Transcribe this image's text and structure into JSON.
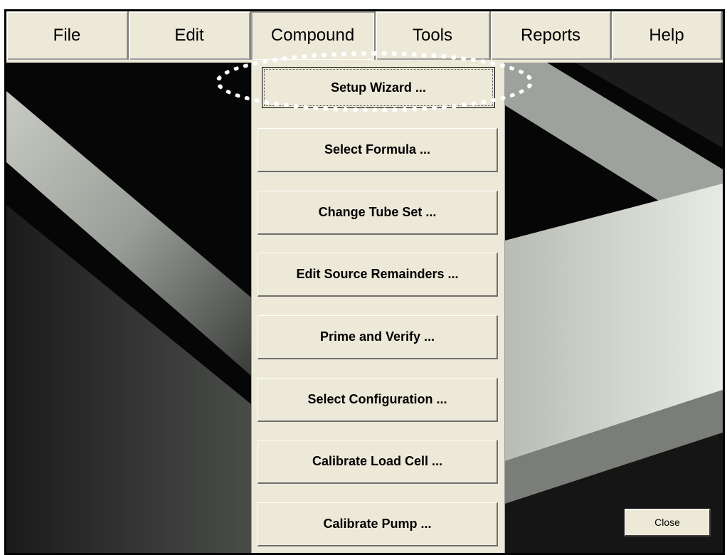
{
  "menubar": {
    "items": [
      {
        "label": "File"
      },
      {
        "label": "Edit"
      },
      {
        "label": "Compound"
      },
      {
        "label": "Tools"
      },
      {
        "label": "Reports"
      },
      {
        "label": "Help"
      }
    ]
  },
  "compound_menu": {
    "items": [
      {
        "label": "Setup Wizard ..."
      },
      {
        "label": "Select Formula ..."
      },
      {
        "label": "Change Tube Set ..."
      },
      {
        "label": "Edit Source Remainders ..."
      },
      {
        "label": "Prime and Verify ..."
      },
      {
        "label": "Select Configuration ..."
      },
      {
        "label": "Calibrate Load Cell ..."
      },
      {
        "label": "Calibrate Pump ..."
      }
    ]
  },
  "close_button": {
    "label": "Close"
  },
  "colors": {
    "window_bg": "#ece9d8",
    "highlight": "#ffffff",
    "frame": "#000000"
  }
}
